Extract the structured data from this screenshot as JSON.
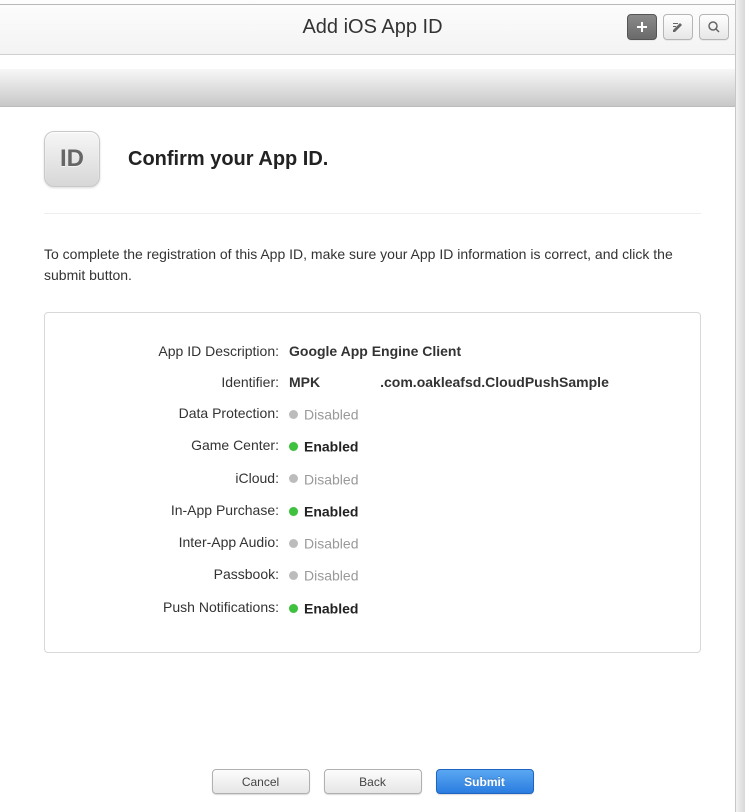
{
  "titlebar": {
    "title": "Add iOS App ID"
  },
  "header": {
    "badge_text": "ID",
    "confirm_title": "Confirm your App ID."
  },
  "instruction": "To complete the registration of this App ID, make sure your App ID information is correct, and click the submit button.",
  "labels": {
    "description": "App ID Description:",
    "identifier": "Identifier:",
    "data_protection": "Data Protection:",
    "game_center": "Game Center:",
    "icloud": "iCloud:",
    "iap": "In-App Purchase:",
    "inter_app_audio": "Inter-App Audio:",
    "passbook": "Passbook:",
    "push": "Push Notifications:"
  },
  "values": {
    "description": "Google App Engine Client",
    "identifier_prefix": "MPK",
    "identifier_bundle": ".com.oakleafsd.CloudPushSample"
  },
  "status": {
    "enabled": "Enabled",
    "disabled": "Disabled",
    "data_protection": false,
    "game_center": true,
    "icloud": false,
    "iap": true,
    "inter_app_audio": false,
    "passbook": false,
    "push": true
  },
  "footer": {
    "cancel": "Cancel",
    "back": "Back",
    "submit": "Submit"
  }
}
